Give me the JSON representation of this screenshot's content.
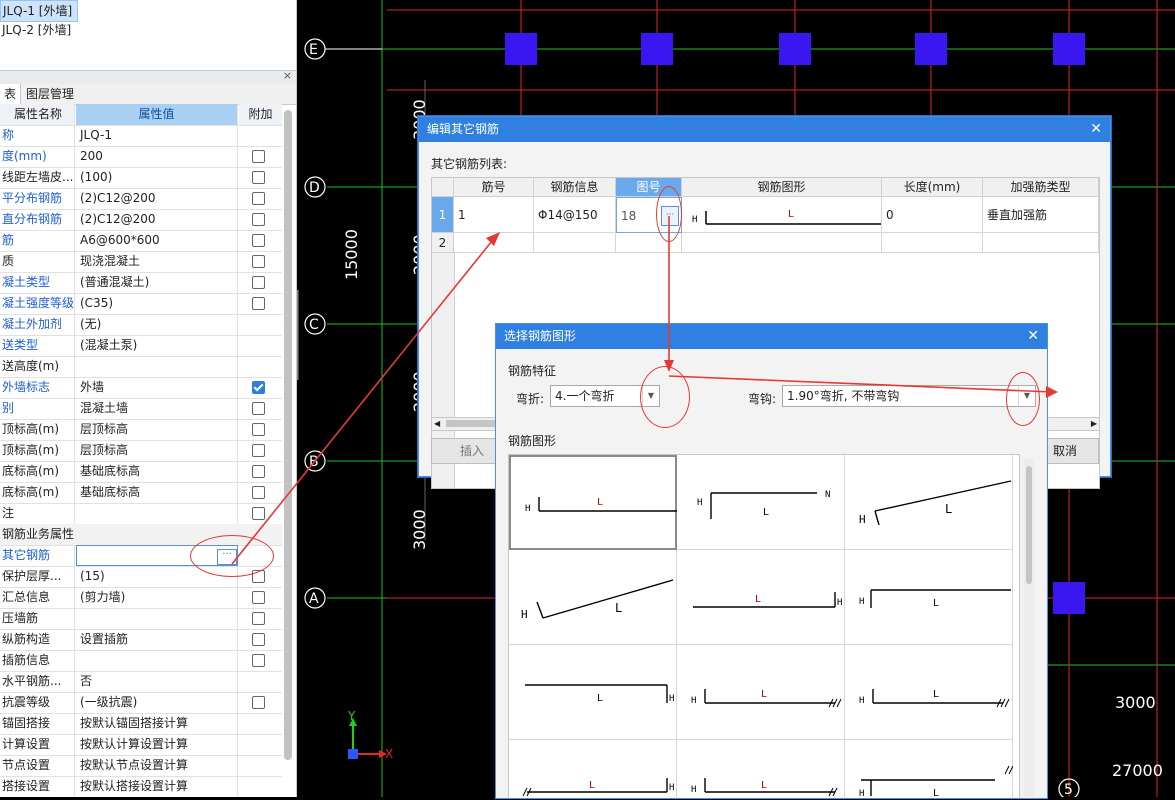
{
  "left_panel": {
    "list": [
      "JLQ-1 [外墙]",
      "JLQ-2 [外墙]"
    ],
    "tabs": [
      "表",
      "图层管理"
    ],
    "close_glyph": "×",
    "columns": [
      "属性名称",
      "属性值",
      "附加"
    ],
    "rows": [
      {
        "name": "称",
        "value": "JLQ-1",
        "blue": true,
        "check": null
      },
      {
        "name": "度(mm)",
        "value": "200",
        "blue": true,
        "check": false
      },
      {
        "name": "线距左墙皮...",
        "value": "(100)",
        "blue": false,
        "check": false
      },
      {
        "name": "平分布钢筋",
        "value": "(2)C12@200",
        "blue": true,
        "check": false
      },
      {
        "name": "直分布钢筋",
        "value": "(2)C12@200",
        "blue": true,
        "check": false
      },
      {
        "name": "筋",
        "value": "A6@600*600",
        "blue": true,
        "check": false
      },
      {
        "name": "质",
        "value": "现浇混凝土",
        "blue": false,
        "check": false
      },
      {
        "name": "凝土类型",
        "value": "(普通混凝土)",
        "blue": true,
        "check": false
      },
      {
        "name": "凝土强度等级",
        "value": "(C35)",
        "blue": true,
        "check": false
      },
      {
        "name": "凝土外加剂",
        "value": "(无)",
        "blue": true,
        "check": null
      },
      {
        "name": "送类型",
        "value": "(混凝土泵)",
        "blue": true,
        "check": null
      },
      {
        "name": "送高度(m)",
        "value": "",
        "blue": false,
        "check": null
      },
      {
        "name": "外墙标志",
        "value": "外墙",
        "blue": true,
        "check": true
      },
      {
        "name": "别",
        "value": "混凝土墙",
        "blue": true,
        "check": false
      },
      {
        "name": "顶标高(m)",
        "value": "层顶标高",
        "blue": false,
        "check": false
      },
      {
        "name": "顶标高(m)",
        "value": "层顶标高",
        "blue": false,
        "check": false
      },
      {
        "name": "底标高(m)",
        "value": "基础底标高",
        "blue": false,
        "check": false
      },
      {
        "name": "底标高(m)",
        "value": "基础底标高",
        "blue": false,
        "check": false
      },
      {
        "name": "注",
        "value": "",
        "blue": false,
        "check": false
      },
      {
        "name": "钢筋业务属性",
        "value": "",
        "blue": false,
        "check": null,
        "group": true
      },
      {
        "name": "其它钢筋",
        "value": "",
        "blue": true,
        "check": null,
        "ellipsis": true
      },
      {
        "name": "保护层厚...",
        "value": "(15)",
        "blue": false,
        "check": false
      },
      {
        "name": "汇总信息",
        "value": "(剪力墙)",
        "blue": false,
        "check": false
      },
      {
        "name": "压墙筋",
        "value": "",
        "blue": false,
        "check": false
      },
      {
        "name": "纵筋构造",
        "value": "设置插筋",
        "blue": false,
        "check": false
      },
      {
        "name": "插筋信息",
        "value": "",
        "blue": false,
        "check": false
      },
      {
        "name": "水平钢筋...",
        "value": "否",
        "blue": false,
        "check": null
      },
      {
        "name": "抗震等级",
        "value": "(一级抗震)",
        "blue": false,
        "check": false
      },
      {
        "name": "锚固搭接",
        "value": "按默认锚固搭接计算",
        "blue": false,
        "check": null
      },
      {
        "name": "计算设置",
        "value": "按默认计算设置计算",
        "blue": false,
        "check": null
      },
      {
        "name": "节点设置",
        "value": "按默认节点设置计算",
        "blue": false,
        "check": null
      },
      {
        "name": "搭接设置",
        "value": "按默认搭接设置计算",
        "blue": false,
        "check": null
      }
    ]
  },
  "cad": {
    "axis_labels": [
      "E",
      "D",
      "C",
      "B",
      "A",
      "5"
    ],
    "dimensions": [
      "3000",
      "15000",
      "3000",
      "3000",
      "2000",
      "2000",
      "2000",
      "27000"
    ],
    "ucs": {
      "x": "X",
      "y": "Y"
    },
    "colors": {
      "grid_green": "#1fbf1f",
      "grid_red": "#e32626",
      "column": "#3a16f0"
    }
  },
  "dialog1": {
    "title": "编辑其它钢筋",
    "list_label": "其它钢筋列表:",
    "columns": [
      "筋号",
      "钢筋信息",
      "图号",
      "钢筋图形",
      "长度(mm)",
      "加强筋类型"
    ],
    "rows": [
      {
        "num": "1",
        "jin_hao": "1",
        "info": "14@150",
        "tu_hao": "18",
        "shape_h": "H",
        "shape_l": "L",
        "length": "0",
        "type": "垂直加强筋"
      },
      {
        "num": "2",
        "jin_hao": "",
        "info": "",
        "tu_hao": "",
        "shape_h": "",
        "shape_l": "",
        "length": "",
        "type": ""
      }
    ],
    "steel_symbol": "Φ",
    "ellipsis": "···",
    "insert_btn": "插入",
    "cancel_btn": "取消"
  },
  "dialog2": {
    "title": "选择钢筋图形",
    "feature_label": "钢筋特征",
    "bend_label": "弯折:",
    "bend_value": "4.一个弯折",
    "hook_label": "弯钩:",
    "hook_value": "1.90°弯折, 不带弯钩",
    "shapes_label": "钢筋图形",
    "glyph_h": "H",
    "glyph_l": "L",
    "glyph_n": "N",
    "arrow_glyph": "▼"
  }
}
